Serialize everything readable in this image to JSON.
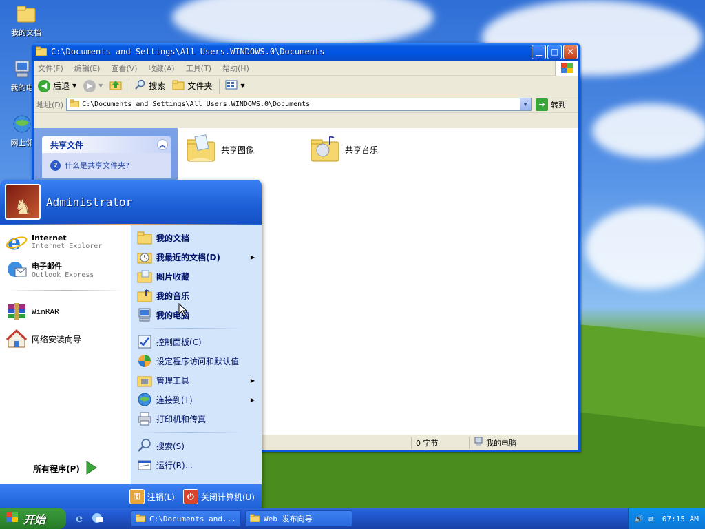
{
  "desktop": {
    "icons": [
      {
        "label": "我的文档",
        "icon": "my-documents-icon"
      },
      {
        "label": "我的电",
        "icon": "my-computer-icon"
      },
      {
        "label": "网上邻",
        "icon": "network-icon"
      }
    ]
  },
  "explorer": {
    "title": "C:\\Documents and Settings\\All Users.WINDOWS.0\\Documents",
    "menu": [
      "文件(F)",
      "编辑(E)",
      "查看(V)",
      "收藏(A)",
      "工具(T)",
      "帮助(H)"
    ],
    "toolbar": {
      "back": "后退",
      "search": "搜索",
      "folders": "文件夹"
    },
    "address": {
      "label": "地址(D)",
      "value": "C:\\Documents and Settings\\All Users.WINDOWS.0\\Documents",
      "go": "转到"
    },
    "task_panel": {
      "title": "共享文件",
      "link": "什么是共享文件夹?"
    },
    "items": [
      {
        "label": "共享图像",
        "icon": "shared-pictures-folder-icon"
      },
      {
        "label": "共享音乐",
        "icon": "shared-music-folder-icon"
      }
    ],
    "status": {
      "size": "0 字节",
      "location": "我的电脑"
    }
  },
  "start_menu": {
    "user": "Administrator",
    "pinned": [
      {
        "title": "Internet",
        "subtitle": "Internet Explorer",
        "icon": "internet-explorer-icon"
      },
      {
        "title": "电子邮件",
        "subtitle": "Outlook Express",
        "icon": "outlook-express-icon"
      }
    ],
    "recent": [
      {
        "title": "WinRAR",
        "icon": "winrar-icon"
      },
      {
        "title": "网络安装向导",
        "icon": "network-setup-icon"
      }
    ],
    "all_programs": "所有程序(P)",
    "right_items_top": [
      {
        "label": "我的文档",
        "icon": "my-documents-icon",
        "arrow": false
      },
      {
        "label": "我最近的文档(D)",
        "icon": "recent-documents-icon",
        "arrow": true
      },
      {
        "label": "图片收藏",
        "icon": "my-pictures-icon",
        "arrow": false
      },
      {
        "label": "我的音乐",
        "icon": "my-music-icon",
        "arrow": false
      },
      {
        "label": "我的电脑",
        "icon": "my-computer-icon",
        "arrow": false
      }
    ],
    "right_items_middle": [
      {
        "label": "控制面板(C)",
        "icon": "control-panel-icon",
        "arrow": false
      },
      {
        "label": "设定程序访问和默认值",
        "icon": "program-defaults-icon",
        "arrow": false
      },
      {
        "label": "管理工具",
        "icon": "admin-tools-icon",
        "arrow": true
      },
      {
        "label": "连接到(T)",
        "icon": "connect-to-icon",
        "arrow": true
      },
      {
        "label": "打印机和传真",
        "icon": "printers-icon",
        "arrow": false
      }
    ],
    "right_items_bottom": [
      {
        "label": "搜索(S)",
        "icon": "search-icon"
      },
      {
        "label": "运行(R)...",
        "icon": "run-icon"
      }
    ],
    "logoff": "注销(L)",
    "shutdown": "关闭计算机(U)"
  },
  "taskbar": {
    "start": "开始",
    "tasks": [
      "C:\\Documents and...",
      "Web 发布向导"
    ],
    "clock": "07:15 AM"
  }
}
